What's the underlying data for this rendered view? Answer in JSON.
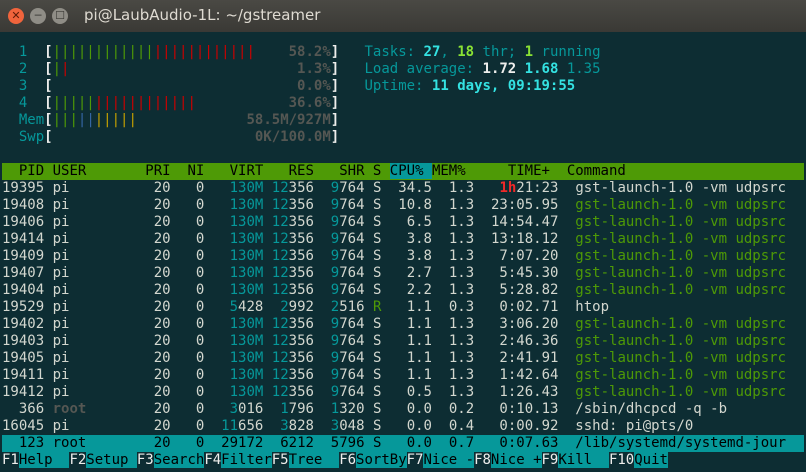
{
  "window": {
    "title": "pi@LaubAudio-1L: ~/gstreamer",
    "close_icon": "✕",
    "min_icon": "─",
    "max_icon": "☐"
  },
  "meters": {
    "cpu": [
      {
        "num": "1",
        "bar_green": "||||||||||||",
        "bar_red": "||||||||||||",
        "value": "58.2%"
      },
      {
        "num": "2",
        "bar_green": "|",
        "bar_red": "|",
        "value": "1.3%"
      },
      {
        "num": "3",
        "bar_green": "",
        "bar_red": "",
        "value": "0.0%"
      },
      {
        "num": "4",
        "bar_green": "|||||",
        "bar_red": "||||||||||||",
        "value": "36.6%"
      }
    ],
    "mem": {
      "label": "Mem",
      "bar_green": "|||",
      "bar_blue": "||",
      "bar_yellow": "|||||",
      "value": "58.5M/927M"
    },
    "swp": {
      "label": "Swp",
      "value": "0K/100.0M"
    }
  },
  "summary": {
    "tasks_label": "Tasks:",
    "tasks": "27",
    "thr": "18",
    "thr_label": "thr;",
    "running": "1",
    "running_label": "running",
    "load_label": "Load average:",
    "load1": "1.72",
    "load5": "1.68",
    "load15": "1.35",
    "uptime_label": "Uptime:",
    "uptime": "11 days, 09:19:55"
  },
  "columns": [
    "PID",
    "USER",
    "PRI",
    "NI",
    "VIRT",
    "RES",
    "SHR",
    "S",
    "CPU%",
    "MEM%",
    "TIME+",
    "Command"
  ],
  "processes": [
    {
      "pid": "19395",
      "user": "pi",
      "pri": "20",
      "ni": "0",
      "virt": "130M",
      "res": "12356",
      "shr": "9764",
      "s": "S",
      "cpu": "34.5",
      "mem": "1.3",
      "time_h": "1h",
      "time": "21:23",
      "cmd": "gst-launch-1.0 -vm udpsrc",
      "cmd_style": "white"
    },
    {
      "pid": "19408",
      "user": "pi",
      "pri": "20",
      "ni": "0",
      "virt": "130M",
      "res": "12356",
      "shr": "9764",
      "s": "S",
      "cpu": "10.8",
      "mem": "1.3",
      "time_h": "",
      "time": "23:05.95",
      "cmd": "gst-launch-1.0 -vm udpsrc",
      "cmd_style": "green"
    },
    {
      "pid": "19406",
      "user": "pi",
      "pri": "20",
      "ni": "0",
      "virt": "130M",
      "res": "12356",
      "shr": "9764",
      "s": "S",
      "cpu": "6.5",
      "mem": "1.3",
      "time_h": "",
      "time": "14:54.47",
      "cmd": "gst-launch-1.0 -vm udpsrc",
      "cmd_style": "green"
    },
    {
      "pid": "19414",
      "user": "pi",
      "pri": "20",
      "ni": "0",
      "virt": "130M",
      "res": "12356",
      "shr": "9764",
      "s": "S",
      "cpu": "3.8",
      "mem": "1.3",
      "time_h": "",
      "time": "13:18.12",
      "cmd": "gst-launch-1.0 -vm udpsrc",
      "cmd_style": "green"
    },
    {
      "pid": "19409",
      "user": "pi",
      "pri": "20",
      "ni": "0",
      "virt": "130M",
      "res": "12356",
      "shr": "9764",
      "s": "S",
      "cpu": "3.8",
      "mem": "1.3",
      "time_h": "",
      "time": "7:07.20",
      "cmd": "gst-launch-1.0 -vm udpsrc",
      "cmd_style": "green"
    },
    {
      "pid": "19407",
      "user": "pi",
      "pri": "20",
      "ni": "0",
      "virt": "130M",
      "res": "12356",
      "shr": "9764",
      "s": "S",
      "cpu": "2.7",
      "mem": "1.3",
      "time_h": "",
      "time": "5:45.30",
      "cmd": "gst-launch-1.0 -vm udpsrc",
      "cmd_style": "green"
    },
    {
      "pid": "19404",
      "user": "pi",
      "pri": "20",
      "ni": "0",
      "virt": "130M",
      "res": "12356",
      "shr": "9764",
      "s": "S",
      "cpu": "2.2",
      "mem": "1.3",
      "time_h": "",
      "time": "5:28.82",
      "cmd": "gst-launch-1.0 -vm udpsrc",
      "cmd_style": "green"
    },
    {
      "pid": "19529",
      "user": "pi",
      "pri": "20",
      "ni": "0",
      "virt": "5428",
      "res": "2992",
      "shr": "2516",
      "s": "R",
      "cpu": "1.1",
      "mem": "0.3",
      "time_h": "",
      "time": "0:02.71",
      "cmd": "htop",
      "cmd_style": "white"
    },
    {
      "pid": "19402",
      "user": "pi",
      "pri": "20",
      "ni": "0",
      "virt": "130M",
      "res": "12356",
      "shr": "9764",
      "s": "S",
      "cpu": "1.1",
      "mem": "1.3",
      "time_h": "",
      "time": "3:06.20",
      "cmd": "gst-launch-1.0 -vm udpsrc",
      "cmd_style": "green"
    },
    {
      "pid": "19403",
      "user": "pi",
      "pri": "20",
      "ni": "0",
      "virt": "130M",
      "res": "12356",
      "shr": "9764",
      "s": "S",
      "cpu": "1.1",
      "mem": "1.3",
      "time_h": "",
      "time": "2:46.36",
      "cmd": "gst-launch-1.0 -vm udpsrc",
      "cmd_style": "green"
    },
    {
      "pid": "19405",
      "user": "pi",
      "pri": "20",
      "ni": "0",
      "virt": "130M",
      "res": "12356",
      "shr": "9764",
      "s": "S",
      "cpu": "1.1",
      "mem": "1.3",
      "time_h": "",
      "time": "2:41.91",
      "cmd": "gst-launch-1.0 -vm udpsrc",
      "cmd_style": "green"
    },
    {
      "pid": "19411",
      "user": "pi",
      "pri": "20",
      "ni": "0",
      "virt": "130M",
      "res": "12356",
      "shr": "9764",
      "s": "S",
      "cpu": "1.1",
      "mem": "1.3",
      "time_h": "",
      "time": "1:42.64",
      "cmd": "gst-launch-1.0 -vm udpsrc",
      "cmd_style": "green"
    },
    {
      "pid": "19412",
      "user": "pi",
      "pri": "20",
      "ni": "0",
      "virt": "130M",
      "res": "12356",
      "shr": "9764",
      "s": "S",
      "cpu": "0.5",
      "mem": "1.3",
      "time_h": "",
      "time": "1:26.43",
      "cmd": "gst-launch-1.0 -vm udpsrc",
      "cmd_style": "green"
    },
    {
      "pid": "366",
      "user": "root",
      "pri": "20",
      "ni": "0",
      "virt": "3016",
      "res": "1796",
      "shr": "1320",
      "s": "S",
      "cpu": "0.0",
      "mem": "0.2",
      "time_h": "",
      "time": "0:10.13",
      "cmd": "/sbin/dhcpcd -q -b",
      "cmd_style": "white"
    },
    {
      "pid": "16045",
      "user": "pi",
      "pri": "20",
      "ni": "0",
      "virt": "11656",
      "res": "3828",
      "shr": "3048",
      "s": "S",
      "cpu": "0.0",
      "mem": "0.4",
      "time_h": "",
      "time": "0:00.92",
      "cmd": "sshd: pi@pts/0",
      "cmd_style": "white"
    },
    {
      "pid": "123",
      "user": "root",
      "pri": "20",
      "ni": "0",
      "virt": "29172",
      "res": "6212",
      "shr": "5796",
      "s": "S",
      "cpu": "0.0",
      "mem": "0.7",
      "time_h": "",
      "time": "0:07.63",
      "cmd": "/lib/systemd/systemd-jour",
      "cmd_style": "selected"
    }
  ],
  "fkeys": [
    {
      "key": "F1",
      "label": "Help  "
    },
    {
      "key": "F2",
      "label": "Setup "
    },
    {
      "key": "F3",
      "label": "Search"
    },
    {
      "key": "F4",
      "label": "Filter"
    },
    {
      "key": "F5",
      "label": "Tree  "
    },
    {
      "key": "F6",
      "label": "SortBy"
    },
    {
      "key": "F7",
      "label": "Nice -"
    },
    {
      "key": "F8",
      "label": "Nice +"
    },
    {
      "key": "F9",
      "label": "Kill  "
    },
    {
      "key": "F10",
      "label": "Quit"
    }
  ]
}
